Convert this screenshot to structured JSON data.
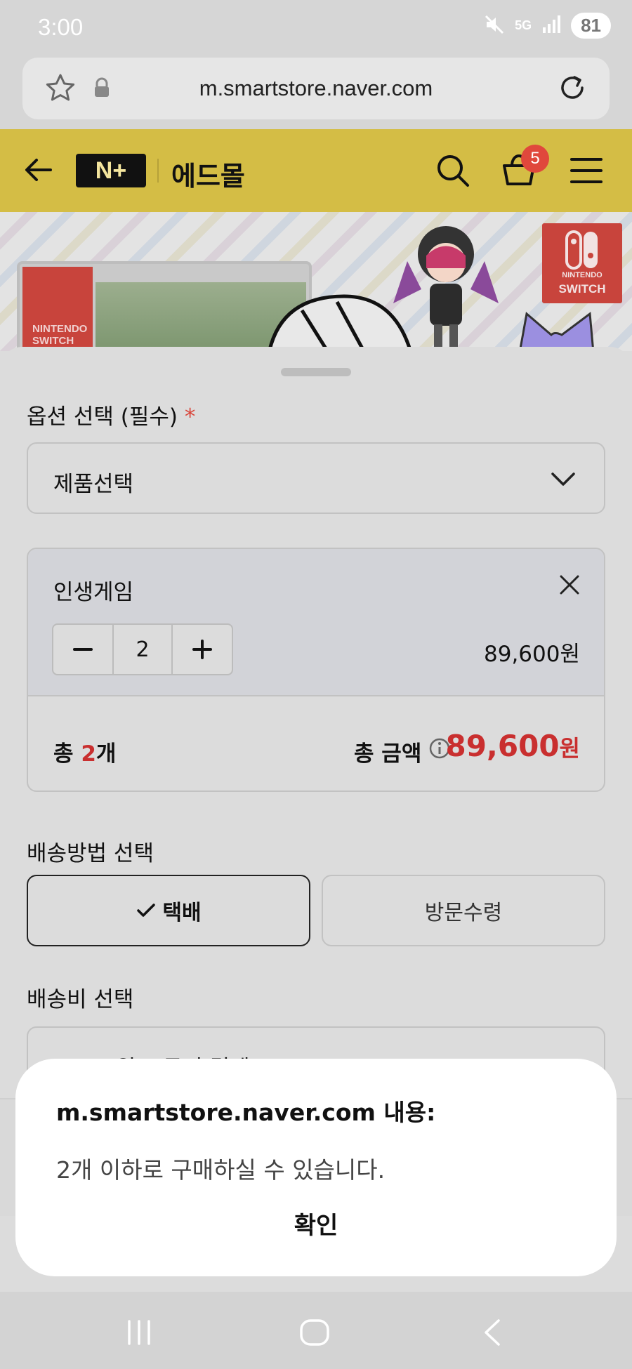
{
  "status_bar": {
    "time": "3:00",
    "battery": "81",
    "network": "5G"
  },
  "browser": {
    "url": "m.smartstore.naver.com"
  },
  "store_header": {
    "logo": "N+",
    "store_name": "에드몰",
    "cart_count": "5"
  },
  "banner": {
    "box_brand": "NINTENDO SWITCH",
    "logo_line1": "NINTENDO",
    "logo_line2": "SWITCH"
  },
  "sheet": {
    "option_label": "옵션 선택 (필수)",
    "required_mark": "*",
    "option_select_value": "제품선택",
    "selected_item": {
      "name": "인생게임",
      "quantity": "2",
      "price": "89,600원"
    },
    "total": {
      "count_prefix": "총",
      "count_value": "2",
      "count_unit": "개",
      "amount_label": "총 금액",
      "amount_value": "89,600",
      "amount_unit": "원"
    },
    "shipping_label": "배송방법 선택",
    "shipping_options": [
      "택배",
      "방문수령"
    ],
    "shipping_fee_label": "배송비 선택",
    "shipping_fee_value": "2,500원 주문시 결제"
  },
  "dialog": {
    "title": "m.smartstore.naver.com 내용:",
    "message": "2개 이하로 구매하실 수 있습니다.",
    "confirm": "확인"
  }
}
